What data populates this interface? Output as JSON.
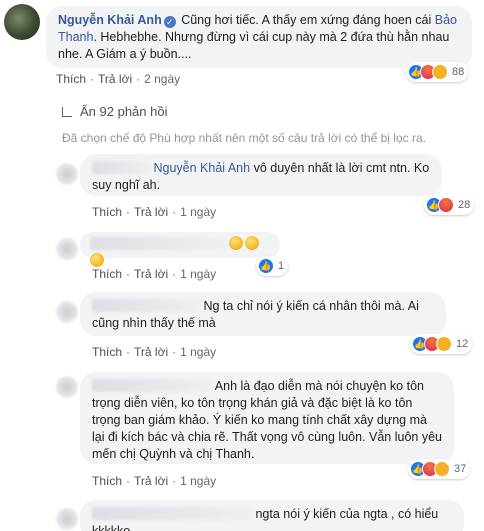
{
  "main_comment": {
    "author": "Nguyễn Khải Anh",
    "text_part1": "Cũng hơi tiếc. A thấy em xứng đáng hoen cái",
    "mention": "Bảo Thanh",
    "text_part2": ". Hebhebhe. Nhưng đừng vì cái cup này mà 2 đứa thù hằn nhau nhe. A Giám a ý buồn....",
    "like_label": "Thích",
    "reply_label": "Trả lời",
    "time": "2 ngày",
    "reaction_count": "88"
  },
  "replies_toggle": {
    "label": "Ẩn 92 phản hồi",
    "filter_note": "Đã chọn chế độ Phù hợp nhất nên một số câu trả lời có thể bị lọc ra."
  },
  "replies": [
    {
      "mention": "Nguyễn Khải Anh",
      "text": " vô duyên nhất là lời cmt ntn. Ko suy nghĩ ah.",
      "like_label": "Thích",
      "reply_label": "Trả lời",
      "time": "1 ngày",
      "reaction_count": "28"
    },
    {
      "text": "",
      "like_label": "Thích",
      "reply_label": "Trả lời",
      "time": "1 ngày",
      "reaction_count": "1"
    },
    {
      "text": "Ng ta chỉ nói ý kiến cá nhân thôi mà. Ai cũng nhìn thấy thế mà",
      "like_label": "Thích",
      "reply_label": "Trả lời",
      "time": "1 ngày",
      "reaction_count": "12"
    },
    {
      "text": "Anh là đạo diễn mà nói chuyện ko tôn trọng diễn viên, ko tôn trọng khán giả và đặc biệt là ko tôn trọng ban giám khảo. Ý kiến ko mang tính chất xây dựng mà lại đi kích bác và chia rẽ. Thất vọng vô cùng luôn. Vẫn luôn yêu mến chị Quỳnh và chị Thanh.",
      "like_label": "Thích",
      "reply_label": "Trả lời",
      "time": "1 ngày",
      "reaction_count": "37"
    },
    {
      "text": "ngta nói ý kiến của ngta , có hiểu kkkkko"
    }
  ],
  "colors": {
    "link_blue": "#385898",
    "bubble_bg": "#f2f3f5",
    "like_blue": "#1877f2",
    "angry_red": "#e0245e"
  }
}
